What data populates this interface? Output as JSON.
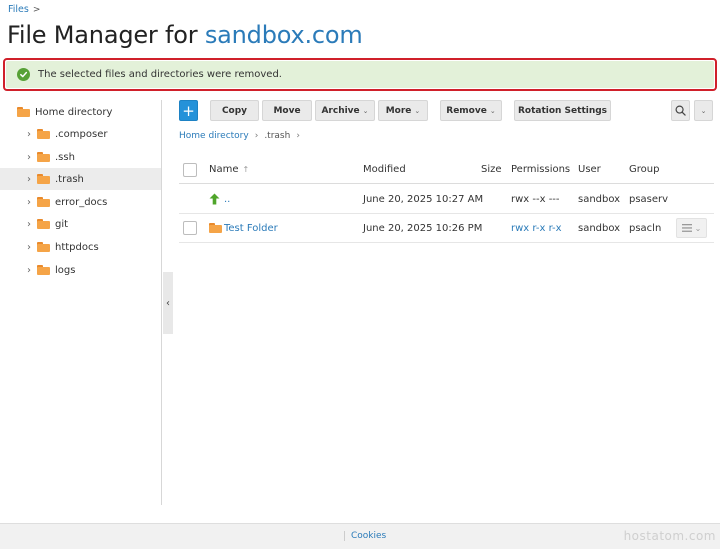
{
  "breadcrumb": {
    "root": "Files",
    "separator": ">"
  },
  "title": {
    "prefix": "File Manager for ",
    "domain": "sandbox.com"
  },
  "alert": {
    "message": "The selected files and directories were removed.",
    "icon": "check-circle-icon",
    "color": "#57a136"
  },
  "sidebar": {
    "root_label": "Home directory",
    "items": [
      {
        "label": ".composer"
      },
      {
        "label": ".ssh"
      },
      {
        "label": ".trash"
      },
      {
        "label": "error_docs"
      },
      {
        "label": "git"
      },
      {
        "label": "httpdocs"
      },
      {
        "label": "logs"
      }
    ]
  },
  "toolbar": {
    "add_label": "+",
    "copy_label": "Copy",
    "move_label": "Move",
    "archive_label": "Archive",
    "more_label": "More",
    "remove_label": "Remove",
    "rotation_label": "Rotation Settings"
  },
  "path": {
    "home": "Home directory",
    "current": ".trash"
  },
  "table": {
    "headers": {
      "name": "Name",
      "modified": "Modified",
      "size": "Size",
      "permissions": "Permissions",
      "user": "User",
      "group": "Group"
    },
    "rows": [
      {
        "name": "..",
        "modified": "June 20, 2025 10:27 AM",
        "size": "",
        "permissions": "rwx --x ---",
        "user": "sandbox",
        "group": "psaserv"
      },
      {
        "name": "Test Folder",
        "modified": "June 20, 2025 10:26 PM",
        "size": "",
        "permissions": "rwx r-x r-x",
        "user": "sandbox",
        "group": "psacln"
      }
    ]
  },
  "footer": {
    "cookies": "Cookies",
    "watermark": "hostatom.com"
  },
  "colors": {
    "accent": "#2b7bb9",
    "alert_border": "#d0202a",
    "alert_bg": "#e3f1d9",
    "folder": "#f5a447",
    "primary_button": "#2592d9"
  }
}
